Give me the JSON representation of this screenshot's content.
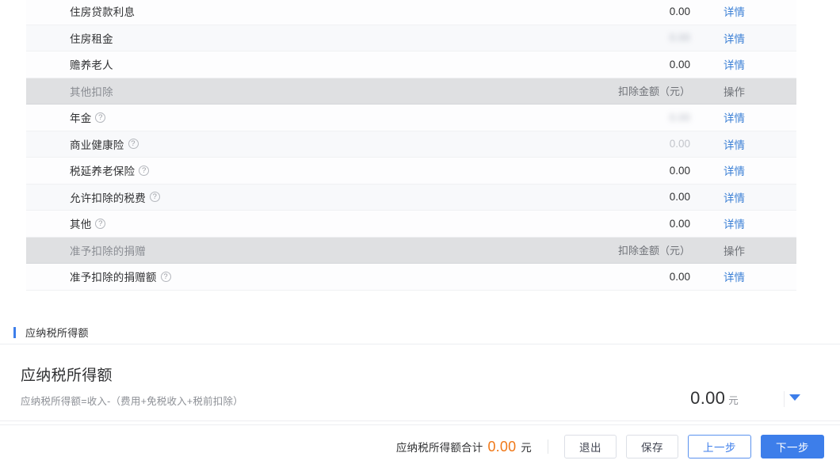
{
  "table": {
    "action_label_detail": "详情",
    "group_amount_header": "扣除金额（元）",
    "group_action_header": "操作",
    "rows": [
      {
        "label": "住房贷款利息",
        "amount": "0.00",
        "action": "详情",
        "kind": "item",
        "help": false,
        "amount_style": "normal"
      },
      {
        "label": "住房租金",
        "amount": "0.00",
        "action": "详情",
        "kind": "item",
        "help": false,
        "amount_style": "blurred"
      },
      {
        "label": "赡养老人",
        "amount": "0.00",
        "action": "详情",
        "kind": "item",
        "help": false,
        "amount_style": "normal"
      },
      {
        "label": "其他扣除",
        "amount": "扣除金额（元）",
        "action": "操作",
        "kind": "group",
        "help": false,
        "amount_style": "normal"
      },
      {
        "label": "年金",
        "amount": "0.00",
        "action": "详情",
        "kind": "item",
        "help": true,
        "amount_style": "blurred"
      },
      {
        "label": "商业健康险",
        "amount": "0.00",
        "action": "详情",
        "kind": "item",
        "help": true,
        "amount_style": "muted"
      },
      {
        "label": "税延养老保险",
        "amount": "0.00",
        "action": "详情",
        "kind": "item",
        "help": true,
        "amount_style": "normal"
      },
      {
        "label": "允许扣除的税费",
        "amount": "0.00",
        "action": "详情",
        "kind": "item",
        "help": true,
        "amount_style": "normal"
      },
      {
        "label": "其他",
        "amount": "0.00",
        "action": "详情",
        "kind": "item",
        "help": true,
        "amount_style": "normal"
      },
      {
        "label": "准予扣除的捐赠",
        "amount": "扣除金额（元）",
        "action": "操作",
        "kind": "group",
        "help": false,
        "amount_style": "normal"
      },
      {
        "label": "准予扣除的捐赠额",
        "amount": "0.00",
        "action": "详情",
        "kind": "item",
        "help": true,
        "amount_style": "normal"
      }
    ]
  },
  "section": {
    "header_title": "应纳税所得额",
    "card_title": "应纳税所得额",
    "formula": "应纳税所得额=收入-（费用+免税收入+税前扣除）",
    "amount": "0.00",
    "unit": "元",
    "caret_icon": "chevron-down-icon"
  },
  "footer": {
    "total_label": "应纳税所得额合计",
    "total_value": "0.00",
    "total_unit": "元",
    "exit_label": "退出",
    "save_label": "保存",
    "prev_label": "上一步",
    "next_label": "下一步"
  },
  "colors": {
    "accent_blue": "#3d7eea",
    "link_blue": "#3a7fd5",
    "total_orange": "#f07818",
    "group_row_bg": "#dfe0e2"
  }
}
